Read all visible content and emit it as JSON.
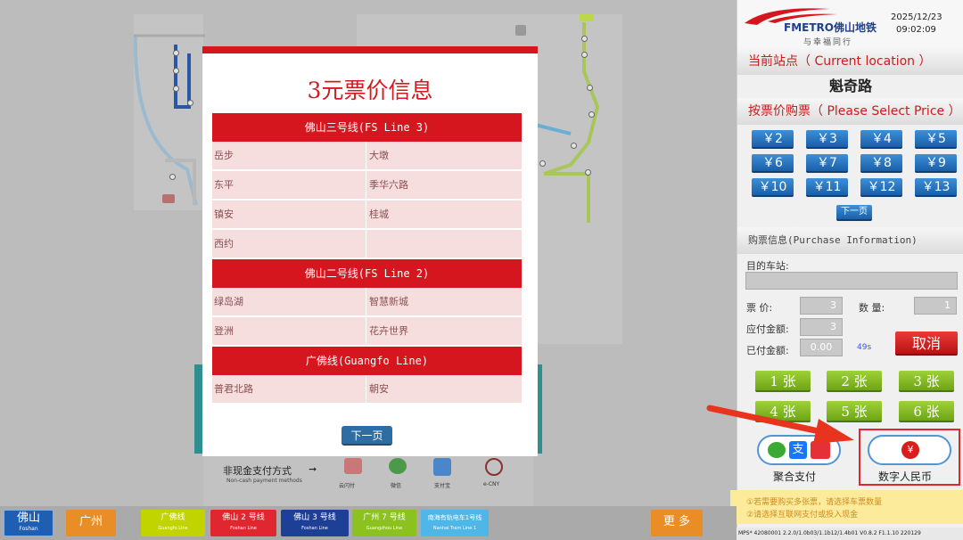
{
  "modal": {
    "title": "3元票价信息",
    "lines": [
      {
        "name": "佛山三号线(FS Line 3)",
        "stations": [
          [
            "岳步",
            "大墩"
          ],
          [
            "东平",
            "季华六路"
          ],
          [
            "镇安",
            "桂城"
          ],
          [
            "西约",
            ""
          ]
        ]
      },
      {
        "name": "佛山二号线(FS Line 2)",
        "stations": [
          [
            "绿岛湖",
            "智慧新城"
          ],
          [
            "登洲",
            "花卉世界"
          ]
        ]
      },
      {
        "name": "广佛线(Guangfo Line)",
        "stations": [
          [
            "普君北路",
            "朝安"
          ]
        ]
      }
    ],
    "next_label": "下一页"
  },
  "header": {
    "brand": "FMETRO佛山地铁",
    "slogan": "与幸福同行",
    "date": "2025/12/23",
    "time": "09:02:09"
  },
  "current_location": {
    "label": "当前站点（ Current location ）",
    "station": "魁奇路"
  },
  "price_select": {
    "label": "按票价购票（ Please Select Price ）",
    "prices": [
      "￥2",
      "￥3",
      "￥4",
      "￥5",
      "￥6",
      "￥7",
      "￥8",
      "￥9",
      "￥10",
      "￥11",
      "￥12",
      "￥13"
    ],
    "next_label": "下一页"
  },
  "purchase_info": {
    "label": "购票信息(Purchase Information)",
    "destination_label": "目的车站:",
    "destination_value": "",
    "price_label": "票    价:",
    "price_value": "3",
    "quantity_label": "数    量:",
    "quantity_value": "1",
    "due_label": "应付金额:",
    "due_value": "3",
    "paid_label": "已付金额:",
    "paid_value": "0.00",
    "countdown": "49s",
    "cancel_label": "取消"
  },
  "quantity_buttons": [
    "1 张",
    "2 张",
    "3 张",
    "4 张",
    "5 张",
    "6 张"
  ],
  "payment": {
    "aggregate_label": "聚合支付",
    "ecny_label": "数字人民币"
  },
  "notice": {
    "line1": "①若需要购买多张票，请选择车票数量",
    "line2": "②请选择互联网支付或投入现金"
  },
  "bottom": {
    "city_foshan": "佛山",
    "city_foshan_en": "Foshan",
    "city_guangzhou": "广州",
    "more_label": "更 多",
    "lines": [
      {
        "name": "广佛线",
        "en": "Guangfo Line",
        "color": "#c2d400"
      },
      {
        "name": "佛山 2 号线",
        "en": "Foshan Line",
        "color": "#e0262e"
      },
      {
        "name": "佛山 3 号线",
        "en": "Foshan Line",
        "color": "#1e3f96"
      },
      {
        "name": "广州 7 号线",
        "en": "Guangzhou Line",
        "color": "#8cc21f"
      },
      {
        "name": "南海有轨电车1号线",
        "en": "Nanhai Tram Line 1",
        "color": "#4fb6e8"
      }
    ]
  },
  "noncash": {
    "title": "非现金支付方式",
    "subtitle": "Non-cash payment methods",
    "items": [
      "云闪付",
      "微信",
      "支付宝",
      "e-CNY"
    ]
  },
  "status_bar": "MPS*   42080001   2.2.0/1.0b03/1.1b12/1.4b01   V0.8.2   F1.1.10   220129"
}
